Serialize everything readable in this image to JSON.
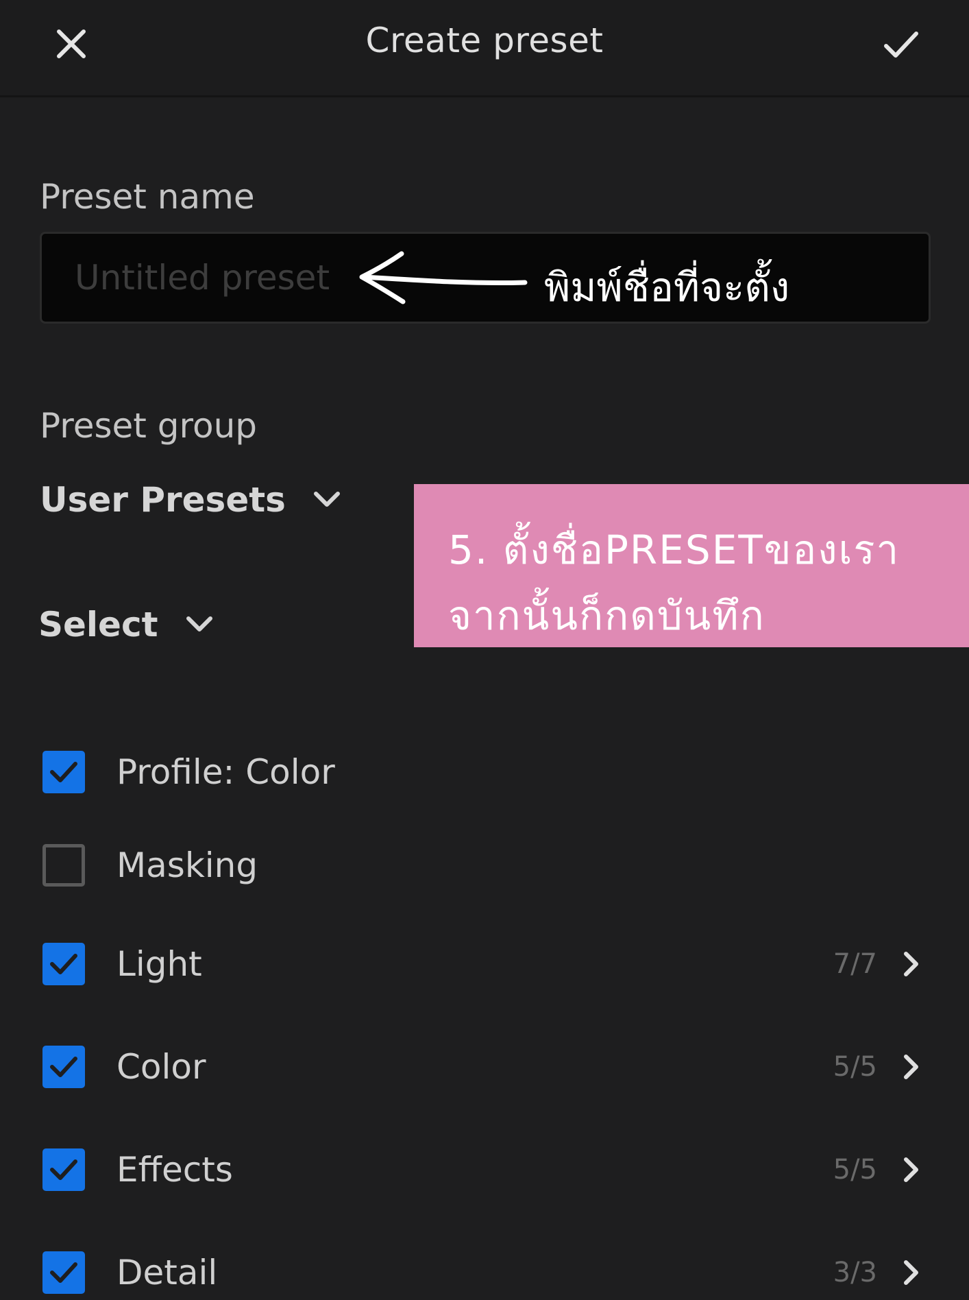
{
  "header": {
    "title": "Create preset",
    "close_icon": "close-icon",
    "confirm_icon": "checkmark-icon"
  },
  "preset_name": {
    "label": "Preset name",
    "placeholder": "Untitled preset",
    "value": ""
  },
  "annotation": {
    "text": "พิมพ์ชื่อที่จะตั้ง",
    "arrow_icon": "arrow-left-icon"
  },
  "preset_group": {
    "label": "Preset group",
    "selected": "User Presets"
  },
  "select_dropdown": {
    "label": "Select"
  },
  "instruction_box": {
    "line1": "5. ตั้งชื่อPRESETของเรา",
    "line2": "จากนั้นก็กดบันทึก",
    "background_color": "#df8ab4"
  },
  "settings": [
    {
      "label": "Profile: Color",
      "checked": true,
      "count": ""
    },
    {
      "label": "Masking",
      "checked": false,
      "count": ""
    },
    {
      "label": "Light",
      "checked": true,
      "count": "7/7"
    },
    {
      "label": "Color",
      "checked": true,
      "count": "5/5"
    },
    {
      "label": "Effects",
      "checked": true,
      "count": "5/5"
    },
    {
      "label": "Detail",
      "checked": true,
      "count": "3/3"
    }
  ],
  "colors": {
    "accent": "#1473e6",
    "background": "#1e1e1f"
  }
}
